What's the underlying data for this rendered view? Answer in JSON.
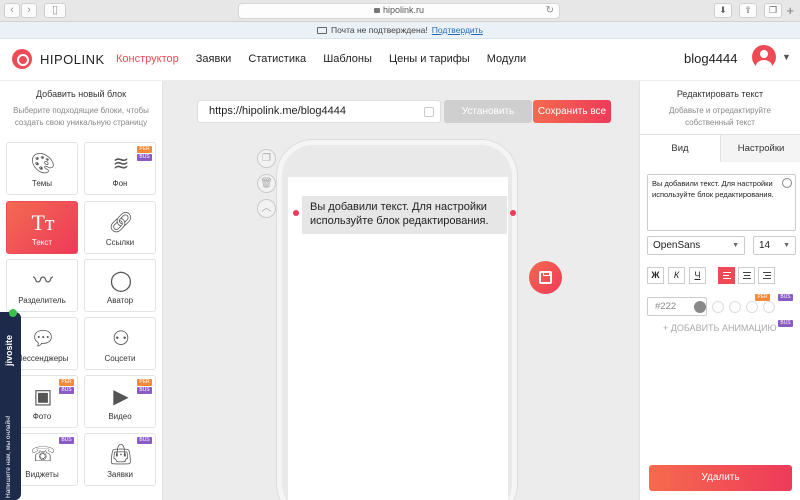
{
  "browser": {
    "url": "hipolink.ru"
  },
  "notice": {
    "text": "Почта не подтверждена!",
    "link": "Подтвердить"
  },
  "header": {
    "brand": "HIPOLINK",
    "nav": [
      "Конструктор",
      "Заявки",
      "Статистика",
      "Шаблоны",
      "Цены и тарифы",
      "Модули"
    ],
    "active_nav": "Конструктор",
    "username": "blog4444",
    "accent_color": "#ee4a55"
  },
  "left": {
    "title": "Добавить новый блок",
    "subtitle": "Выберите подходящие блоки, чтобы создать свою уникальную страницу",
    "blocks": [
      {
        "label": "Темы",
        "icon": "palette-icon"
      },
      {
        "label": "Фон",
        "icon": "layers-icon",
        "badges": [
          "PER",
          "BUS"
        ]
      },
      {
        "label": "Текст",
        "icon": "text-icon",
        "active": true
      },
      {
        "label": "Ссылки",
        "icon": "link-icon"
      },
      {
        "label": "Разделитель",
        "icon": "divider-icon"
      },
      {
        "label": "Аватор",
        "icon": "avatar-icon"
      },
      {
        "label": "Мессенджеры",
        "icon": "chat-icon"
      },
      {
        "label": "Соцсети",
        "icon": "network-icon"
      },
      {
        "label": "Фото",
        "icon": "photo-icon",
        "badges": [
          "PER",
          "BUS"
        ]
      },
      {
        "label": "Видео",
        "icon": "video-icon",
        "badges": [
          "PER",
          "BUS"
        ]
      },
      {
        "label": "Виджеты",
        "icon": "phone-icon",
        "badges": [
          "BUS"
        ]
      },
      {
        "label": "Заявки",
        "icon": "bag-icon",
        "badges": [
          "BUS"
        ]
      }
    ]
  },
  "jivo": {
    "brand": "jivosite",
    "message": "Напишите нам, мы онлайн!"
  },
  "center": {
    "url_value": "https://hipolink.me/blog4444",
    "install_label": "Установить",
    "save_all_label": "Сохранить все",
    "preview_text": "Вы добавили текст. Для настройки используйте блок редактирования."
  },
  "right": {
    "title": "Редактировать текст",
    "subtitle": "Добавьте и отредактируйте собственный текст",
    "tabs": [
      "Вид",
      "Настройки"
    ],
    "active_tab": "Вид",
    "text_value": "Вы добавили текст. Для настройки используйте блок редактирования.",
    "font": "OpenSans",
    "font_size": "14",
    "format_buttons": [
      "Ж",
      "К",
      "Ч"
    ],
    "color_value": "#222",
    "badges": [
      "PER",
      "BUS"
    ],
    "add_animation": "+ ДОБАВИТЬ АНИМАЦИЮ",
    "delete_label": "Удалить"
  }
}
